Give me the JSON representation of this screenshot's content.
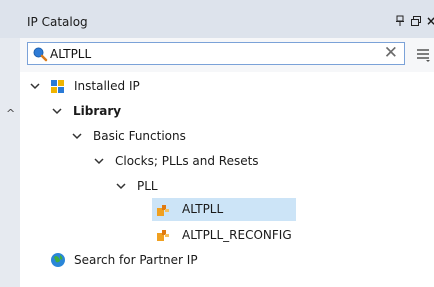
{
  "panel": {
    "title": "IP Catalog",
    "pin_icon": "pin-icon",
    "float_icon": "float-window-icon",
    "close_icon": "close-icon"
  },
  "search": {
    "value": "ALTPLL",
    "icon": "search-icon",
    "clear_icon": "clear-icon",
    "menu_icon": "menu-icon"
  },
  "tree": {
    "installed": "Installed IP",
    "library": "Library",
    "basic": "Basic Functions",
    "clocks": "Clocks; PLLs and Resets",
    "pll": "PLL",
    "altpll": "ALTPLL",
    "altpll_reconfig": "ALTPLL_RECONFIG",
    "partner": "Search for Partner IP"
  },
  "colors": {
    "header_bg": "#dde3ec",
    "selection_bg": "#cce4f7",
    "search_border": "#7ba2d8"
  }
}
